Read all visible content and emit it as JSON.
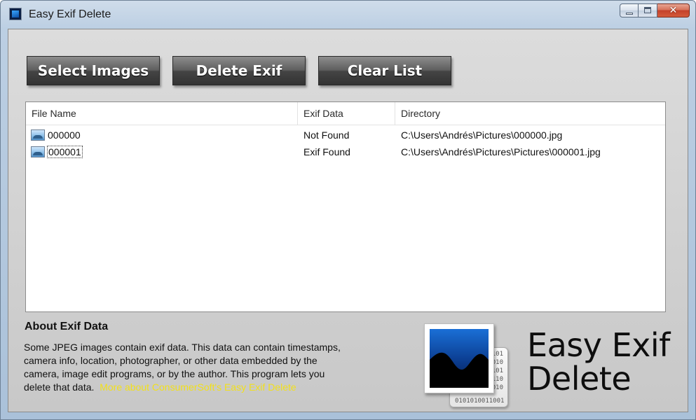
{
  "window": {
    "title": "Easy Exif Delete",
    "close_glyph": "✕"
  },
  "toolbar": {
    "select_images": "Select Images",
    "delete_exif": "Delete Exif",
    "clear_list": "Clear List"
  },
  "list": {
    "columns": [
      "File Name",
      "Exif Data",
      "Directory"
    ],
    "rows": [
      {
        "name": "000000",
        "exif": "Not Found",
        "directory": "C:\\Users\\Andrés\\Pictures\\000000.jpg"
      },
      {
        "name": "000001",
        "exif": "Exif Found",
        "directory": "C:\\Users\\Andrés\\Pictures\\Pictures\\000001.jpg"
      }
    ]
  },
  "about": {
    "title": "About Exif Data",
    "line1": "Some JPEG images contain exif data. This data can contain timestamps,",
    "line2": "camera info, location, photographer, or other data embedded by the",
    "line3": "camera, image edit programs, or by the author. This program lets you",
    "line4": "delete that data.",
    "link": "More about ConsumerSoft's Easy Exif Delete",
    "link_color": "#f2e01b"
  },
  "logo": {
    "word1": "Easy Exif",
    "word2": "Delete",
    "binary_lines": [
      "101",
      "010",
      "101",
      "110",
      "010"
    ],
    "binary_bottom": "0101010011001"
  },
  "icons": {
    "app": "app-photo-icon",
    "row": "image-file-icon"
  }
}
